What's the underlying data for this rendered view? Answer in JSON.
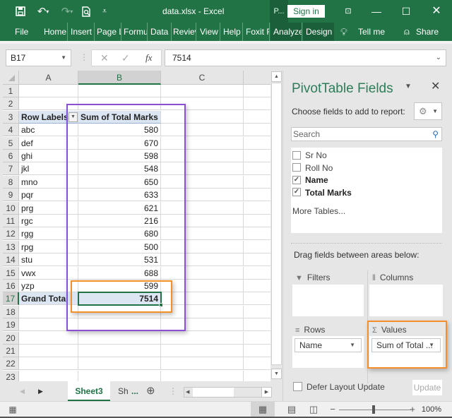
{
  "window": {
    "title": "data.xlsx  -  Excel",
    "context_tab_label": "P...",
    "signin_label": "Sign in"
  },
  "ribbon": {
    "tabs": [
      "File",
      "Home",
      "Insert",
      "Page L",
      "Formu",
      "Data",
      "Reviev",
      "View",
      "Help",
      "Foxit F",
      "Analyze",
      "Design"
    ],
    "tell_me": "Tell me",
    "share": "Share"
  },
  "formula_bar": {
    "name_box": "B17",
    "formula": "7514",
    "fx_label": "fx"
  },
  "sheet": {
    "columns": [
      "A",
      "B",
      "C"
    ],
    "selected_column": "B",
    "selected_cell": "B17",
    "row_numbers": [
      "1",
      "2",
      "3",
      "4",
      "5",
      "6",
      "7",
      "8",
      "9",
      "10",
      "11",
      "12",
      "13",
      "14",
      "15",
      "16",
      "17",
      "18",
      "19",
      "20",
      "21",
      "22",
      "23"
    ],
    "pivot": {
      "row_labels_header": "Row Labels",
      "values_header": "Sum of Total Marks",
      "rows": [
        {
          "label": "abc",
          "value": "580"
        },
        {
          "label": "def",
          "value": "670"
        },
        {
          "label": "ghi",
          "value": "598"
        },
        {
          "label": "jkl",
          "value": "548"
        },
        {
          "label": "mno",
          "value": "650"
        },
        {
          "label": "pqr",
          "value": "633"
        },
        {
          "label": "prg",
          "value": "621"
        },
        {
          "label": "rgc",
          "value": "216"
        },
        {
          "label": "rgg",
          "value": "680"
        },
        {
          "label": "rpg",
          "value": "500"
        },
        {
          "label": "stu",
          "value": "531"
        },
        {
          "label": "vwx",
          "value": "688"
        },
        {
          "label": "yzp",
          "value": "599"
        }
      ],
      "grand_total_label": "Grand Total",
      "grand_total_value": "7514"
    },
    "highlight_colors": {
      "purple": "#8b4fd1",
      "orange": "#f4902a",
      "selection": "#217346"
    }
  },
  "sheet_tabs": {
    "active": "Sheet3",
    "other": "Sh",
    "ellipsis": "..."
  },
  "status_bar": {
    "zoom": "100%"
  },
  "pivot_pane": {
    "title": "PivotTable Fields",
    "choose_label": "Choose fields to add to report:",
    "search_placeholder": "Search",
    "fields": [
      {
        "name": "Sr No",
        "checked": false
      },
      {
        "name": "Roll No",
        "checked": false
      },
      {
        "name": "Name",
        "checked": true
      },
      {
        "name": "Total Marks",
        "checked": true
      }
    ],
    "more_tables": "More Tables...",
    "drag_label": "Drag fields between areas below:",
    "areas": {
      "filters": "Filters",
      "columns": "Columns",
      "rows": "Rows",
      "values": "Values"
    },
    "rows_item": "Name",
    "values_item": "Sum of Total ...",
    "defer_label": "Defer Layout Update",
    "update_label": "Update"
  }
}
